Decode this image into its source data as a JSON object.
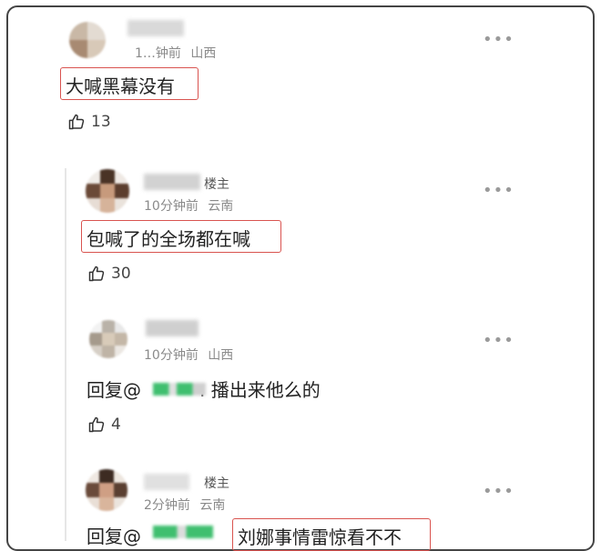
{
  "comments": [
    {
      "time": "1…钟前",
      "location": "山西",
      "text": "大喊黑幕没有",
      "likes": "13",
      "more": "•••"
    },
    {
      "host_tag": "楼主",
      "time": "10分钟前",
      "location": "云南",
      "text": "包喊了的全场都在喊",
      "likes": "30",
      "more": "•••"
    },
    {
      "time": "10分钟前",
      "location": "山西",
      "reply_prefix": "回复@",
      "reply_rest": ". 播出来他么的",
      "likes": "4",
      "more": "•••"
    },
    {
      "host_tag": "楼主",
      "time": "2分钟前",
      "location": "云南",
      "reply_prefix": "回复@",
      "boxed_text": "刘娜事情雷惊看不不",
      "more": "•••"
    }
  ],
  "icons": {
    "like": "thumbs-up-icon",
    "more": "more-dots-icon"
  },
  "colors": {
    "highlight_box": "#d9534f",
    "meta_text": "#8a8a8a",
    "thread_line": "#e6e6e6"
  }
}
